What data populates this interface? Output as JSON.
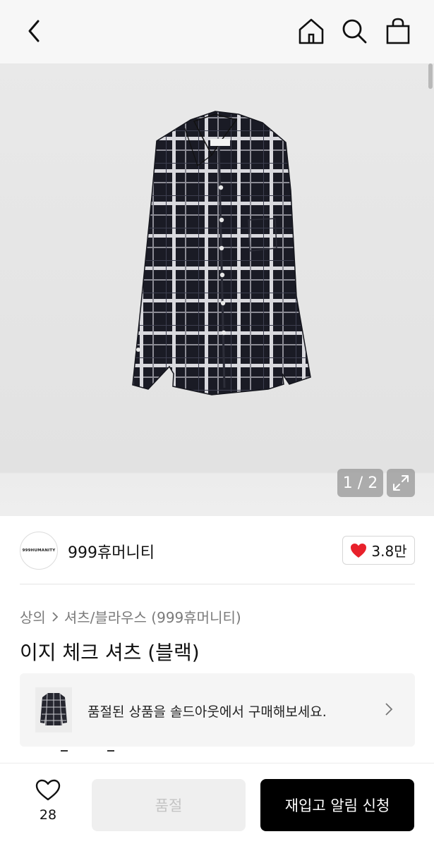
{
  "header": {
    "back_icon": "chevron-left-icon",
    "home_icon": "home-icon",
    "search_icon": "search-icon",
    "bag_icon": "shopping-bag-icon"
  },
  "gallery": {
    "current": "1",
    "separator": "/",
    "total": "2",
    "counter_text": "1 / 2",
    "expand_icon": "expand-icon"
  },
  "brand": {
    "logo_text": "999HUMANITY",
    "name": "999휴머니티",
    "like_count": "3.8만",
    "like_icon": "heart-filled-icon"
  },
  "breadcrumb": {
    "category": "상의",
    "subcategory": "셔츠/블라우스 (999휴머니티)"
  },
  "product": {
    "title": "이지 체크 셔츠 (블랙)"
  },
  "soldout_banner": {
    "text": "품절된 상품을 솔드아웃에서 구매해보세요."
  },
  "bottom_bar": {
    "wish_count": "28",
    "soldout_label": "품절",
    "restock_label": "재입고 알림 신청"
  },
  "colors": {
    "accent_black": "#000000",
    "heart_red": "#e8212b",
    "disabled_gray": "#efefef"
  }
}
